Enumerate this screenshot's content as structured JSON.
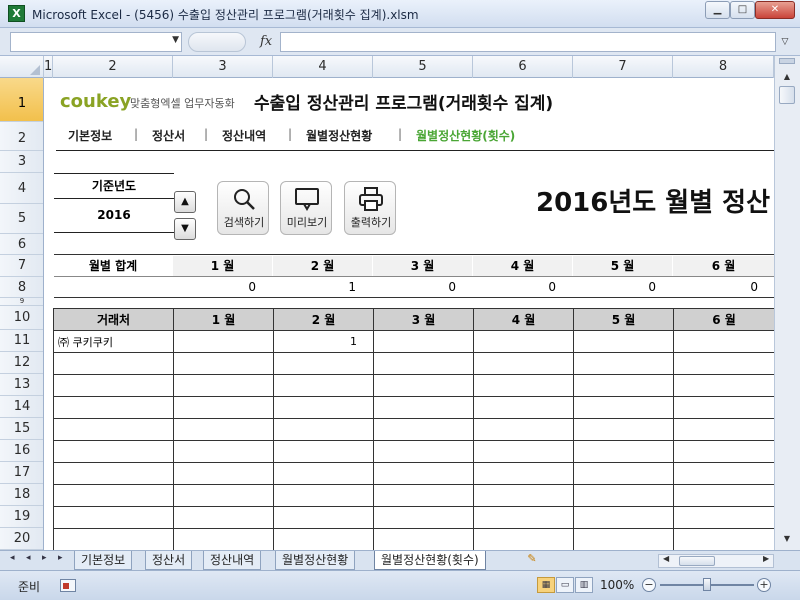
{
  "window": {
    "app_icon": "X",
    "title": "Microsoft Excel - (5456) 수출입 정산관리 프로그램(거래횟수 집계).xlsm",
    "min": "▁",
    "max": "□",
    "close": "✕"
  },
  "formula_bar": {
    "name_box": "",
    "fx": "fx",
    "formula": ""
  },
  "columns": [
    "1",
    "2",
    "3",
    "4",
    "5",
    "6",
    "7",
    "8"
  ],
  "rows": [
    "1",
    "2",
    "3",
    "4",
    "5",
    "6",
    "7",
    "8",
    "9",
    "10",
    "11",
    "12",
    "13",
    "14",
    "15",
    "16",
    "17",
    "18",
    "19",
    "20"
  ],
  "brand": {
    "logo": "coukey",
    "tagline": "맞춤형엑셀 업무자동화"
  },
  "sheet_title": "수출입 정산관리 프로그램(거래횟수 집계)",
  "nav": {
    "items": [
      "기본정보",
      "정산서",
      "정산내역",
      "월별정산현황",
      "월별정산현황(횟수)"
    ],
    "separator": "|",
    "active_index": 4,
    "active_color": "#4aa635"
  },
  "year": {
    "label": "기준년도",
    "value": "2016",
    "up": "▲",
    "down": "▼"
  },
  "toolbar": {
    "search": "검색하기",
    "preview": "미리보기",
    "print": "출력하기"
  },
  "big_title": "2016년도 월별 정산",
  "monthly_sum": {
    "label": "월별 합계",
    "months": [
      "1 월",
      "2 월",
      "3 월",
      "4 월",
      "5 월",
      "6 월"
    ],
    "values": [
      "0",
      "1",
      "0",
      "0",
      "0",
      "0"
    ]
  },
  "client_table": {
    "headers": [
      "거래처",
      "1 월",
      "2 월",
      "3 월",
      "4 월",
      "5 월",
      "6 월"
    ],
    "rows": [
      [
        "㈜ 쿠키쿠키",
        "",
        "1",
        "",
        "",
        "",
        ""
      ],
      [
        "",
        "",
        "",
        "",
        "",
        "",
        ""
      ],
      [
        "",
        "",
        "",
        "",
        "",
        "",
        ""
      ],
      [
        "",
        "",
        "",
        "",
        "",
        "",
        ""
      ],
      [
        "",
        "",
        "",
        "",
        "",
        "",
        ""
      ],
      [
        "",
        "",
        "",
        "",
        "",
        "",
        ""
      ],
      [
        "",
        "",
        "",
        "",
        "",
        "",
        ""
      ],
      [
        "",
        "",
        "",
        "",
        "",
        "",
        ""
      ],
      [
        "",
        "",
        "",
        "",
        "",
        "",
        ""
      ],
      [
        "",
        "",
        "",
        "",
        "",
        "",
        ""
      ]
    ]
  },
  "sheet_tabs": {
    "nav": [
      "◂",
      "◂",
      "▸",
      "▸"
    ],
    "tabs": [
      "기본정보",
      "정산서",
      "정산내역",
      "월별정산현황",
      "월별정산현황(횟수)"
    ],
    "active_index": 4
  },
  "status": {
    "ready": "준비",
    "zoom": "100%",
    "zoom_minus": "−",
    "zoom_plus": "+"
  },
  "colors": {
    "brand_green": "#8aa324",
    "header_gray": "#d0d0d0",
    "active_row_header": "#f2c04c"
  }
}
